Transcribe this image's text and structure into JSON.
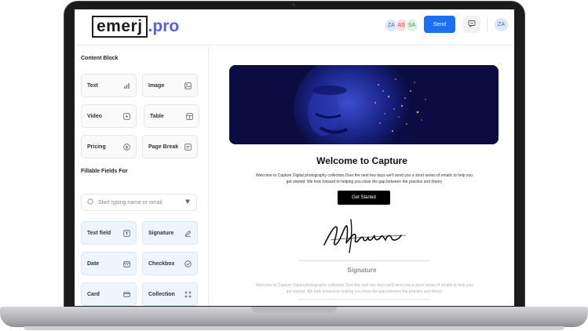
{
  "app": {
    "logo_main": "emerj",
    "logo_suffix": ".pro"
  },
  "header": {
    "collaborators": [
      "ZA",
      "AS",
      "SA"
    ],
    "send_label": "Send",
    "user_initials": "ZA"
  },
  "sidebar": {
    "content_block_title": "Content Block",
    "content_blocks": [
      {
        "label": "Text",
        "icon": "text-block-icon"
      },
      {
        "label": "Image",
        "icon": "image-icon"
      },
      {
        "label": "Video",
        "icon": "video-icon"
      },
      {
        "label": "Table",
        "icon": "table-icon"
      },
      {
        "label": "Pricing",
        "icon": "dollar-icon"
      },
      {
        "label": "Page Break",
        "icon": "page-break-icon"
      }
    ],
    "fillable_title": "Fillable Fields For",
    "search_placeholder": "Start typing name or email",
    "fillable_fields": [
      {
        "label": "Text field",
        "icon": "text-field-icon"
      },
      {
        "label": "Signature",
        "icon": "pen-icon"
      },
      {
        "label": "Date",
        "icon": "calendar-icon"
      },
      {
        "label": "Checkbox",
        "icon": "check-circle-icon"
      },
      {
        "label": "Card",
        "icon": "card-icon"
      },
      {
        "label": "Collection",
        "icon": "grid-dots-icon"
      }
    ]
  },
  "document": {
    "title": "Welcome to Capture",
    "intro_line1": "Welcome to Capture Digital photography collection.Over the next few days we'll send you a short series of emails to help you",
    "intro_line2": "get started. We look forward to helping you close the gap between the practice and theory",
    "cta_label": "Get Started",
    "signature_name": "Maulana",
    "signature_label": "Signature",
    "footer_line1": "Welcome to Capture Digital photography collection.Over the next few days we'll send you a short series of emails to help you",
    "footer_line2": "get started. We look forward to helping you close the gap between the practice and theory"
  },
  "colors": {
    "accent": "#1e6ff0",
    "brand": "#5b5fd9",
    "tile_blue": "#eef6fd"
  }
}
